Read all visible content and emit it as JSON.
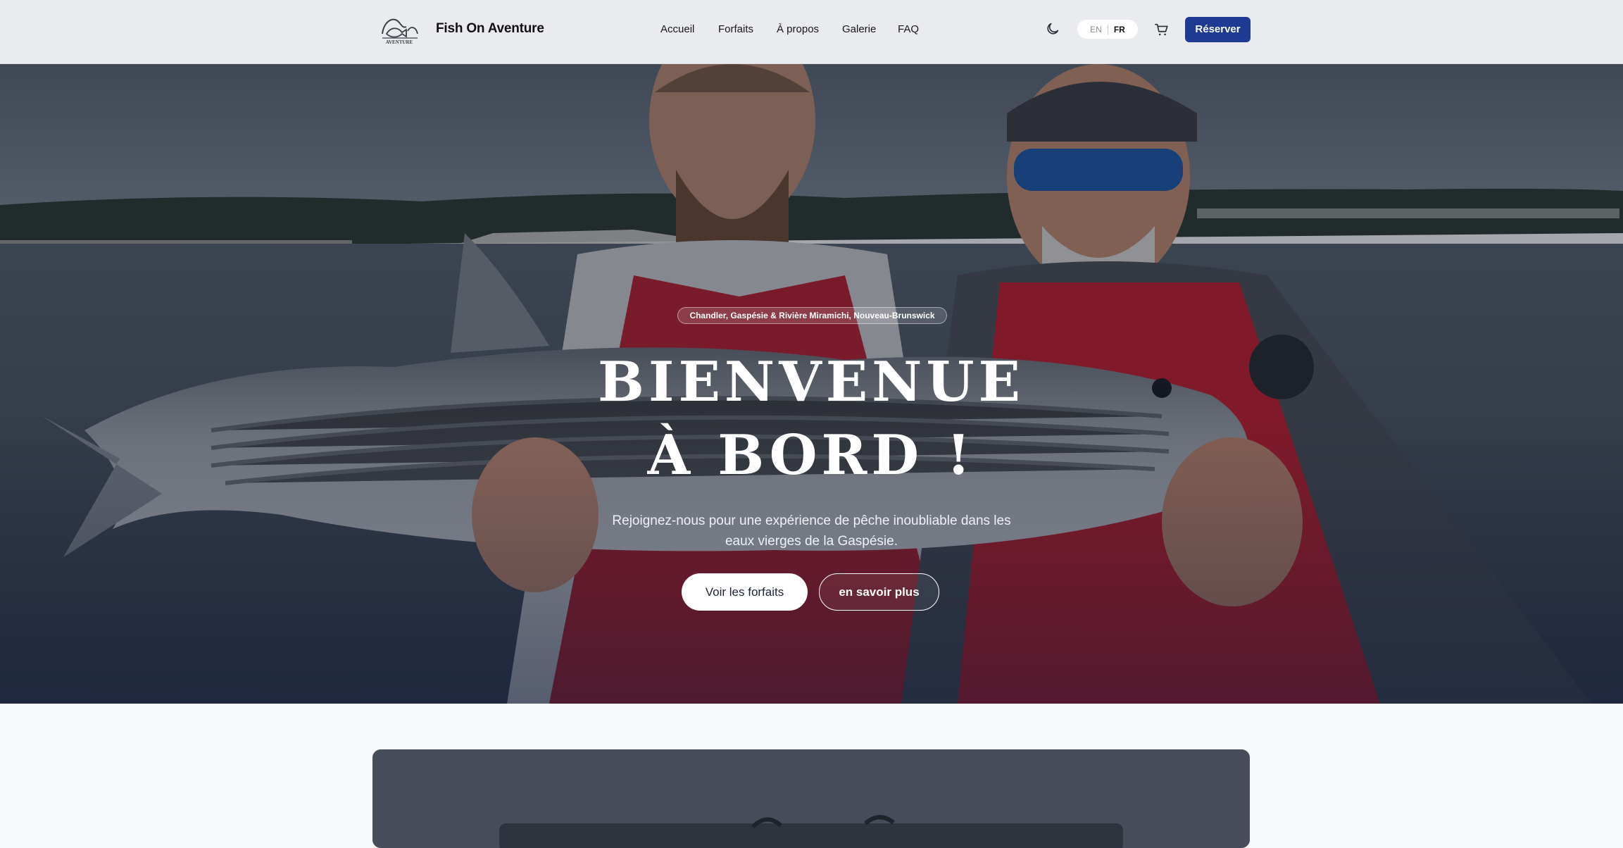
{
  "header": {
    "brand": "Fish On Aventure",
    "logo_text": "AVENTURE",
    "nav": [
      "Accueil",
      "Forfaits",
      "À propos",
      "Galerie",
      "FAQ"
    ],
    "theme_toggle_icon": "moon-icon",
    "lang": {
      "en": "EN",
      "fr": "FR",
      "active": "FR"
    },
    "cart_icon": "cart-icon",
    "reserve_label": "Réserver"
  },
  "hero": {
    "badge": "Chandler, Gaspésie & Rivière Miramichi, Nouveau-Brunswick",
    "title_line1": "BIENVENUE",
    "title_line2": "À BORD !",
    "subtitle": "Rejoignez-nous pour une expérience de pêche inoubliable dans les eaux vierges de la Gaspésie.",
    "primary_cta": "Voir les forfaits",
    "secondary_cta": "en savoir plus"
  },
  "colors": {
    "accent": "#1f3a93",
    "header_bg": "#e9ebee",
    "page_bg": "#f7f8fa"
  }
}
